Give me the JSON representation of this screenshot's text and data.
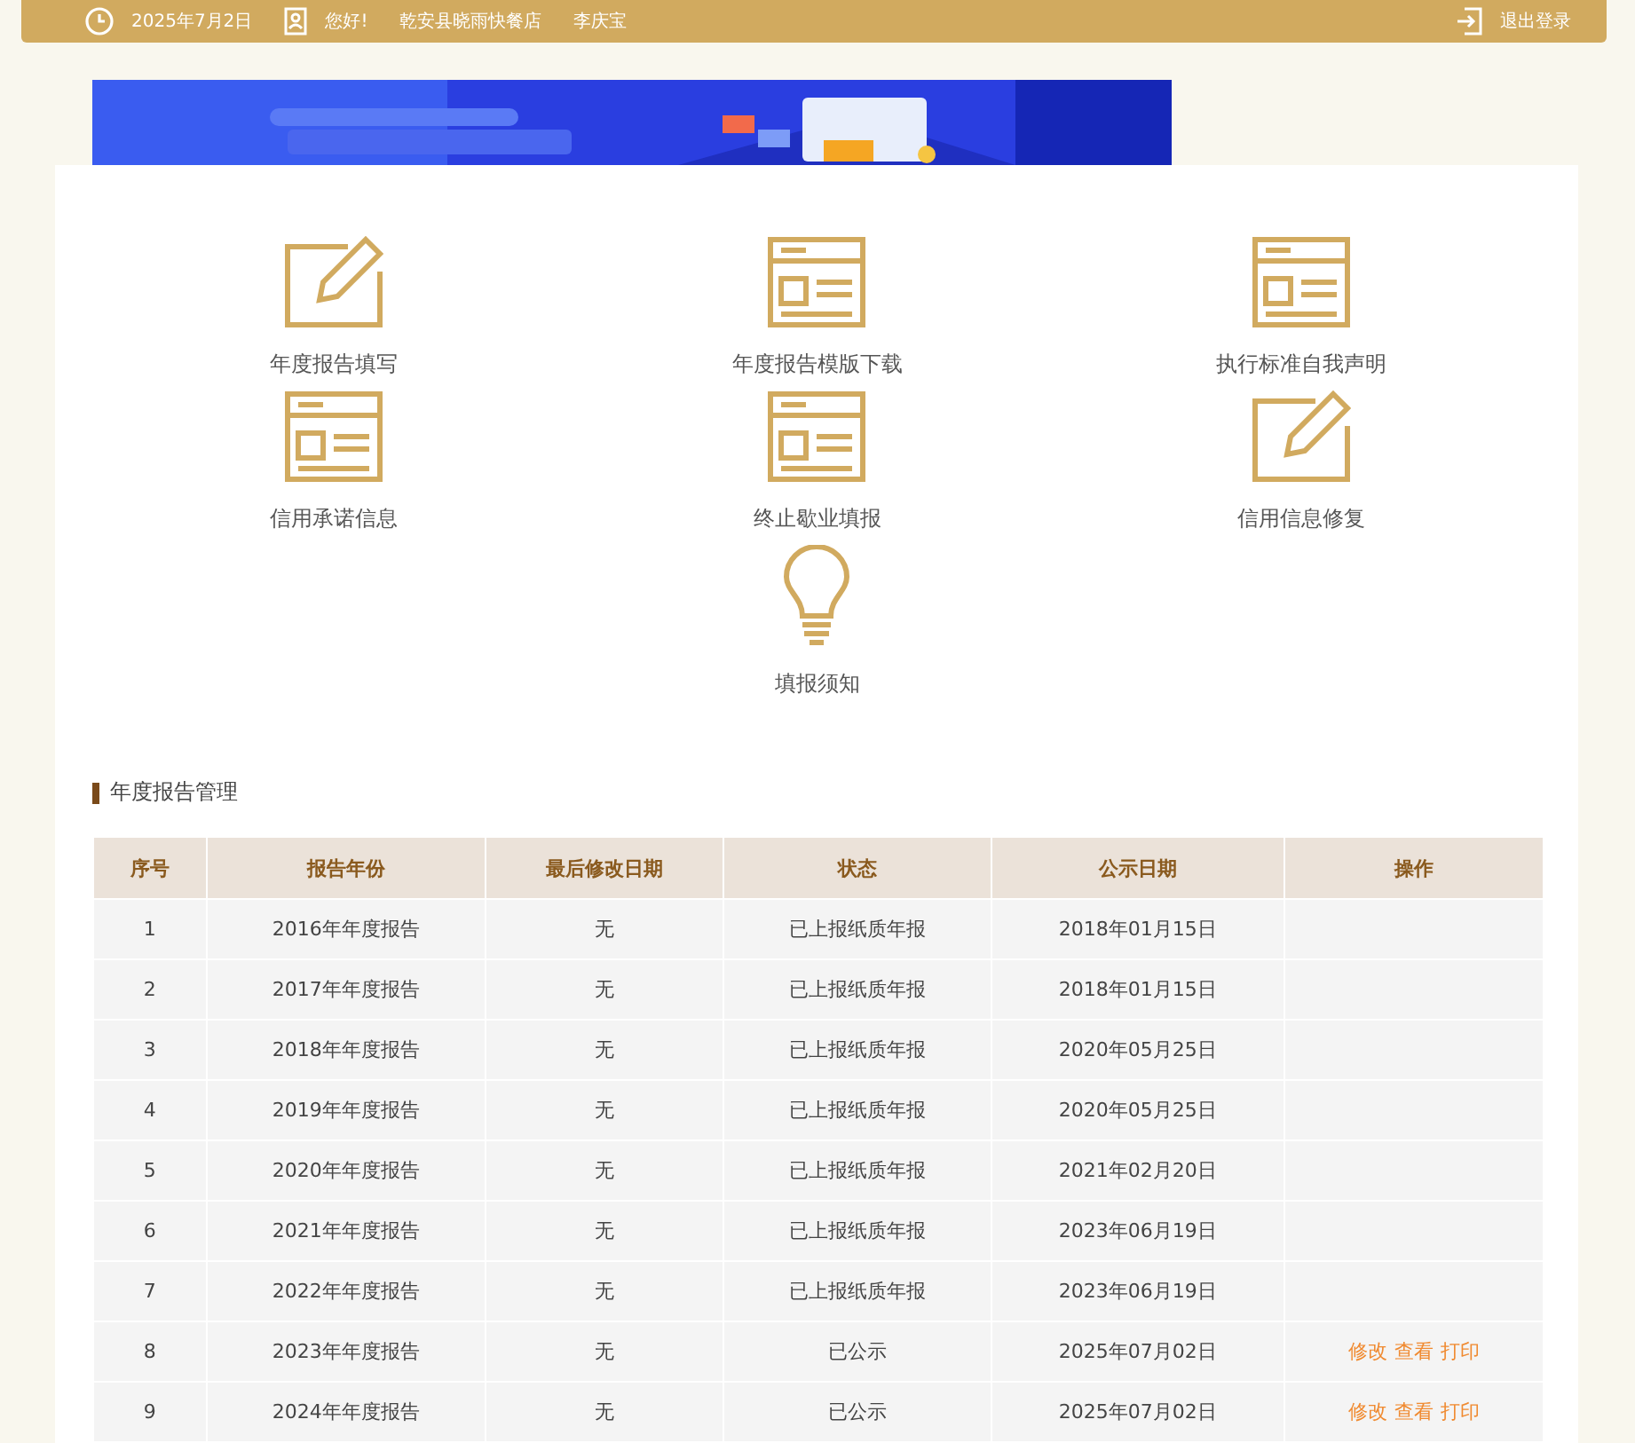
{
  "top_bar": {
    "date": "2025年7月2日",
    "greeting": "您好!",
    "company": "乾安县晓雨快餐店",
    "user": "李庆宝",
    "logout": "退出登录"
  },
  "shortcuts": [
    {
      "label": "年度报告填写",
      "kind": "pencil"
    },
    {
      "label": "年度报告模版下载",
      "kind": "form"
    },
    {
      "label": "执行标准自我声明",
      "kind": "form"
    },
    {
      "label": "信用承诺信息",
      "kind": "form"
    },
    {
      "label": "终止歇业填报",
      "kind": "form"
    },
    {
      "label": "信用信息修复",
      "kind": "pencil"
    },
    {
      "label": "填报须知",
      "kind": "bulb"
    }
  ],
  "section_title": "年度报告管理",
  "table": {
    "columns": [
      "序号",
      "报告年份",
      "最后修改日期",
      "状态",
      "公示日期",
      "操作"
    ],
    "rows": [
      {
        "cells": [
          "1",
          "2016年年度报告",
          "无",
          "已上报纸质年报",
          "2018年01月15日"
        ],
        "actions": []
      },
      {
        "cells": [
          "2",
          "2017年年度报告",
          "无",
          "已上报纸质年报",
          "2018年01月15日"
        ],
        "actions": []
      },
      {
        "cells": [
          "3",
          "2018年年度报告",
          "无",
          "已上报纸质年报",
          "2020年05月25日"
        ],
        "actions": []
      },
      {
        "cells": [
          "4",
          "2019年年度报告",
          "无",
          "已上报纸质年报",
          "2020年05月25日"
        ],
        "actions": []
      },
      {
        "cells": [
          "5",
          "2020年年度报告",
          "无",
          "已上报纸质年报",
          "2021年02月20日"
        ],
        "actions": []
      },
      {
        "cells": [
          "6",
          "2021年年度报告",
          "无",
          "已上报纸质年报",
          "2023年06月19日"
        ],
        "actions": []
      },
      {
        "cells": [
          "7",
          "2022年年度报告",
          "无",
          "已上报纸质年报",
          "2023年06月19日"
        ],
        "actions": []
      },
      {
        "cells": [
          "8",
          "2023年年度报告",
          "无",
          "已公示",
          "2025年07月02日"
        ],
        "actions": [
          "修改",
          "查看",
          "打印"
        ]
      },
      {
        "cells": [
          "9",
          "2024年年度报告",
          "无",
          "已公示",
          "2025年07月02日"
        ],
        "actions": [
          "修改",
          "查看",
          "打印"
        ]
      }
    ]
  }
}
